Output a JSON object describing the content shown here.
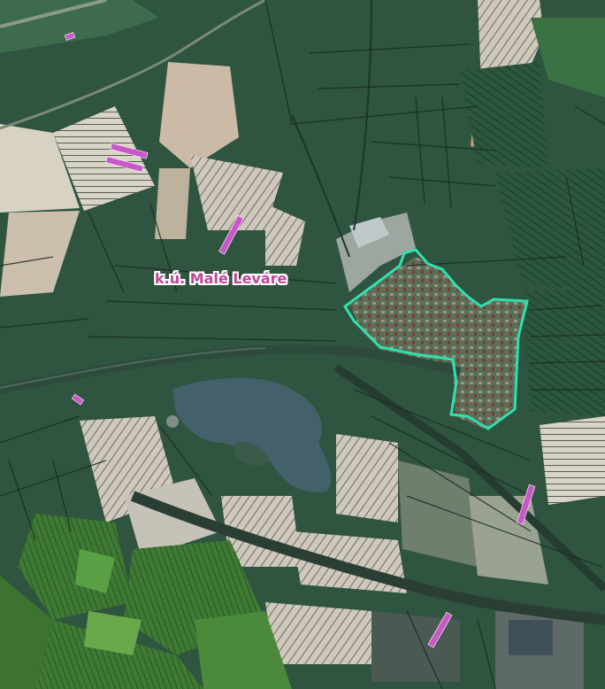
{
  "map": {
    "place_label": "k.ú. Malé Leváre",
    "colors": {
      "boundary": "#30e0b0",
      "parcel_highlight": "#c858c8",
      "label_text": "#c2459a",
      "parcel_lines": "#1a2e22",
      "water": "#44606a",
      "green_tint": "#4f9a3c"
    }
  }
}
